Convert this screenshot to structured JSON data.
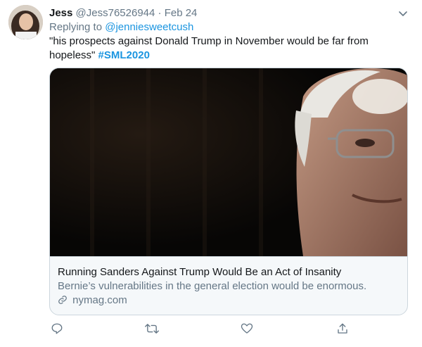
{
  "tweet": {
    "author_name": "Jess",
    "author_handle": "@Jess76526944",
    "separator": "·",
    "date": "Feb 24",
    "replying_prefix": "Replying to",
    "replying_handle": "@jenniesweetcush",
    "text": "\"his prospects against Donald Trump in November would be far from hopeless\"",
    "hashtag": "#SML2020"
  },
  "card": {
    "title": "Running Sanders Against Trump Would Be an Act of Insanity",
    "description": "Bernie’s vulnerabilities in the general election would be enormous.",
    "domain": "nymag.com"
  },
  "icons": {
    "reply": "reply-icon",
    "retweet": "retweet-icon",
    "like": "heart-icon",
    "share": "share-icon",
    "more": "chevron-down-icon",
    "link": "link-icon"
  },
  "colors": {
    "link": "#1b95e0",
    "muted": "#657786",
    "text": "#14171a",
    "border": "#ccd6dd"
  }
}
